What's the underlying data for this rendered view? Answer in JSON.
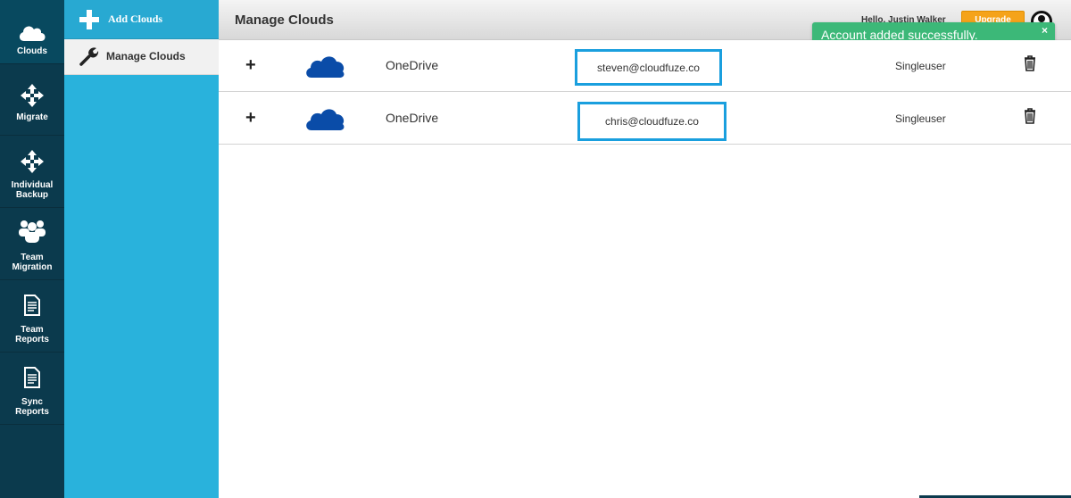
{
  "nav": {
    "items": [
      {
        "label": "Clouds",
        "icon": "cloud-icon"
      },
      {
        "label": "Migrate",
        "icon": "move-arrows-icon"
      },
      {
        "label": "Individual\nBackup",
        "icon": "move-arrows-icon"
      },
      {
        "label": "Team\nMigration",
        "icon": "team-icon"
      },
      {
        "label": "Team\nReports",
        "icon": "report-icon"
      },
      {
        "label": "Sync\nReports",
        "icon": "report-icon"
      }
    ]
  },
  "submenu": {
    "add_label": "Add Clouds",
    "manage_label": "Manage Clouds"
  },
  "header": {
    "title": "Manage Clouds",
    "hello": "Hello, Justin Walker",
    "upgrade_label": "Upgrade"
  },
  "toast": {
    "message": "Account added successfully.",
    "close_symbol": "×"
  },
  "rows": [
    {
      "expand": "+",
      "cloud": "OneDrive",
      "email": "steven@cloudfuze.co",
      "type": "Singleuser"
    },
    {
      "expand": "+",
      "cloud": "OneDrive",
      "email": "chris@cloudfuze.co",
      "type": "Singleuser"
    }
  ],
  "colors": {
    "nav_bg": "#0b3a4d",
    "submenu_bg": "#29b2dc",
    "toast_bg": "#3cb878",
    "upgrade_bg": "#f5a31a",
    "highlight_border": "#1a9fde",
    "onedrive_blue": "#0a4ca8"
  }
}
